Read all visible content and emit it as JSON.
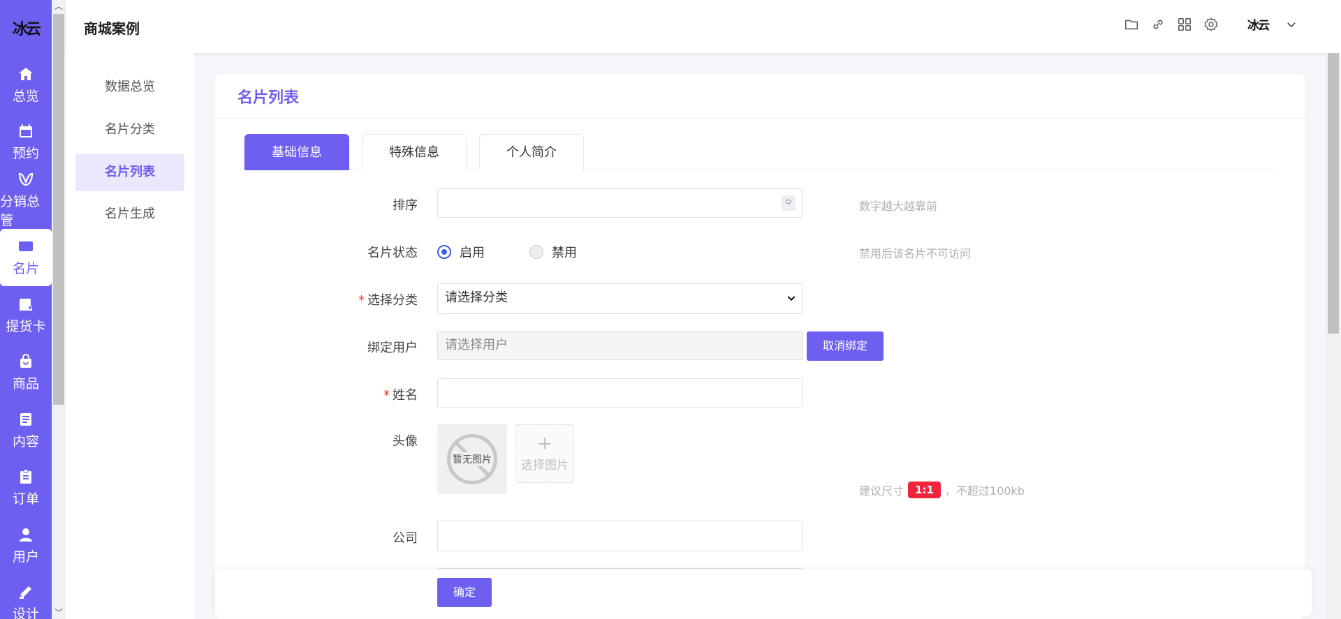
{
  "app": {
    "logo_text": "冰云",
    "title": "商城案例"
  },
  "sidebar": {
    "items": [
      {
        "label": "总览",
        "icon": "home-icon"
      },
      {
        "label": "预约",
        "icon": "calendar-icon"
      },
      {
        "label": "分销总管",
        "icon": "distribution-icon"
      },
      {
        "label": "名片",
        "icon": "card-icon",
        "active": true
      },
      {
        "label": "提货卡",
        "icon": "pickup-card-icon"
      },
      {
        "label": "商品",
        "icon": "shopping-bag-icon"
      },
      {
        "label": "内容",
        "icon": "document-icon"
      },
      {
        "label": "订单",
        "icon": "clipboard-icon"
      },
      {
        "label": "用户",
        "icon": "user-icon"
      },
      {
        "label": "设计",
        "icon": "design-icon"
      }
    ]
  },
  "header": {
    "icons": [
      "folder-icon",
      "link-icon",
      "grid-icon",
      "gear-icon"
    ],
    "user_logo": "冰云"
  },
  "submenu": {
    "items": [
      {
        "label": "数据总览"
      },
      {
        "label": "名片分类"
      },
      {
        "label": "名片列表",
        "active": true
      },
      {
        "label": "名片生成"
      }
    ]
  },
  "card": {
    "title": "名片列表"
  },
  "tabs": [
    {
      "label": "基础信息",
      "active": true
    },
    {
      "label": "特殊信息"
    },
    {
      "label": "个人简介"
    }
  ],
  "form": {
    "sort": {
      "label": "排序",
      "value": "",
      "hint": "数字越大越靠前"
    },
    "status": {
      "label": "名片状态",
      "options": [
        "启用",
        "禁用"
      ],
      "selected": "启用",
      "hint": "禁用后该名片不可访问"
    },
    "category": {
      "label": "选择分类",
      "required": "*",
      "value": "请选择分类"
    },
    "bind_user": {
      "label": "绑定用户",
      "placeholder": "请选择用户",
      "button": "取消绑定"
    },
    "name": {
      "label": "姓名",
      "required": "*",
      "value": ""
    },
    "avatar": {
      "label": "头像",
      "empty_text": "暂无图片",
      "upload_plus": "+",
      "upload_text": "选择图片",
      "hint_prefix": "建议尺寸",
      "ratio": "1:1",
      "hint_suffix": "，不超过100kb"
    },
    "company": {
      "label": "公司",
      "value": ""
    }
  },
  "footer": {
    "confirm": "确定"
  },
  "colors": {
    "accent": "#6d5ff0",
    "required": "#f04134",
    "badge": "#f0243a",
    "radio": "#3c62e0"
  }
}
